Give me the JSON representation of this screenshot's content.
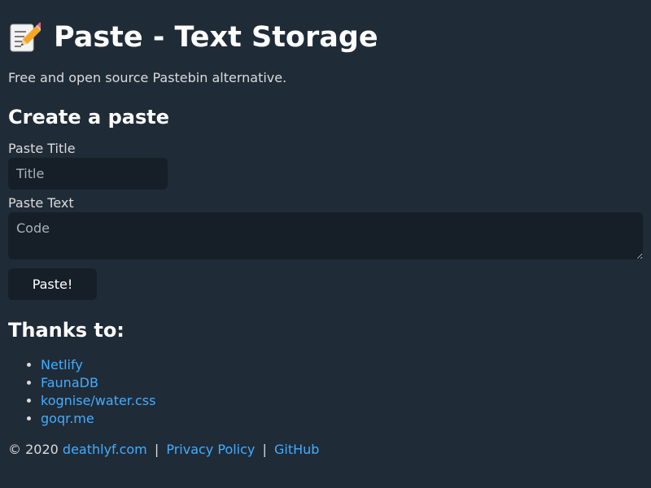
{
  "header": {
    "icon": "memo-icon",
    "title": "Paste - Text Storage",
    "subtitle": "Free and open source Pastebin alternative."
  },
  "form": {
    "heading": "Create a paste",
    "title_label": "Paste Title",
    "title_placeholder": "Title",
    "title_value": "",
    "text_label": "Paste Text",
    "text_placeholder": "Code",
    "text_value": "",
    "submit_label": "Paste!"
  },
  "thanks": {
    "heading": "Thanks to:",
    "items": [
      {
        "label": "Netlify"
      },
      {
        "label": "FaunaDB"
      },
      {
        "label": "kognise/water.css"
      },
      {
        "label": "goqr.me"
      }
    ]
  },
  "footer": {
    "copyright": "© 2020",
    "author_link": "deathlyf.com",
    "separator": "|",
    "privacy_link": "Privacy Policy",
    "github_link": "GitHub"
  },
  "colors": {
    "background": "#202b38",
    "input_background": "#161f27",
    "link": "#41adff",
    "text": "#dbdbdb",
    "heading": "#ffffff"
  }
}
